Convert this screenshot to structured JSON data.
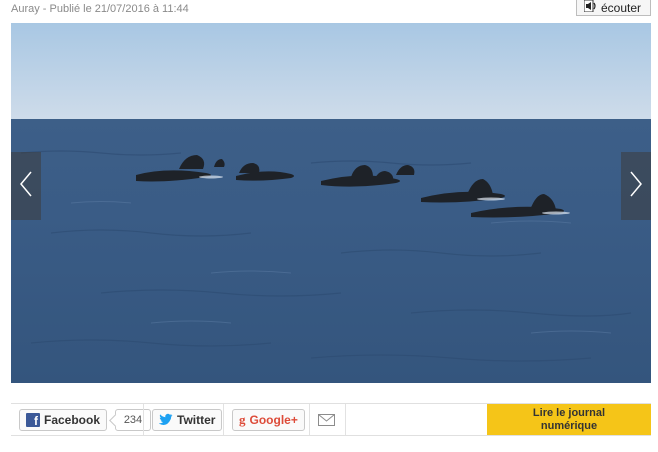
{
  "article": {
    "meta": "Auray - Publié le 21/07/2016 à 11:44"
  },
  "listen": {
    "label": "écouter"
  },
  "share": {
    "facebook": {
      "label": "Facebook",
      "count": "234"
    },
    "twitter": {
      "label": "Twitter"
    },
    "google": {
      "label": "Google+"
    },
    "read_journal": {
      "line1": "Lire le journal",
      "line2": "numérique"
    }
  },
  "colors": {
    "facebook": "#3b5998",
    "twitter": "#1da1f2",
    "google": "#dd4b39",
    "cta": "#f5c518"
  }
}
